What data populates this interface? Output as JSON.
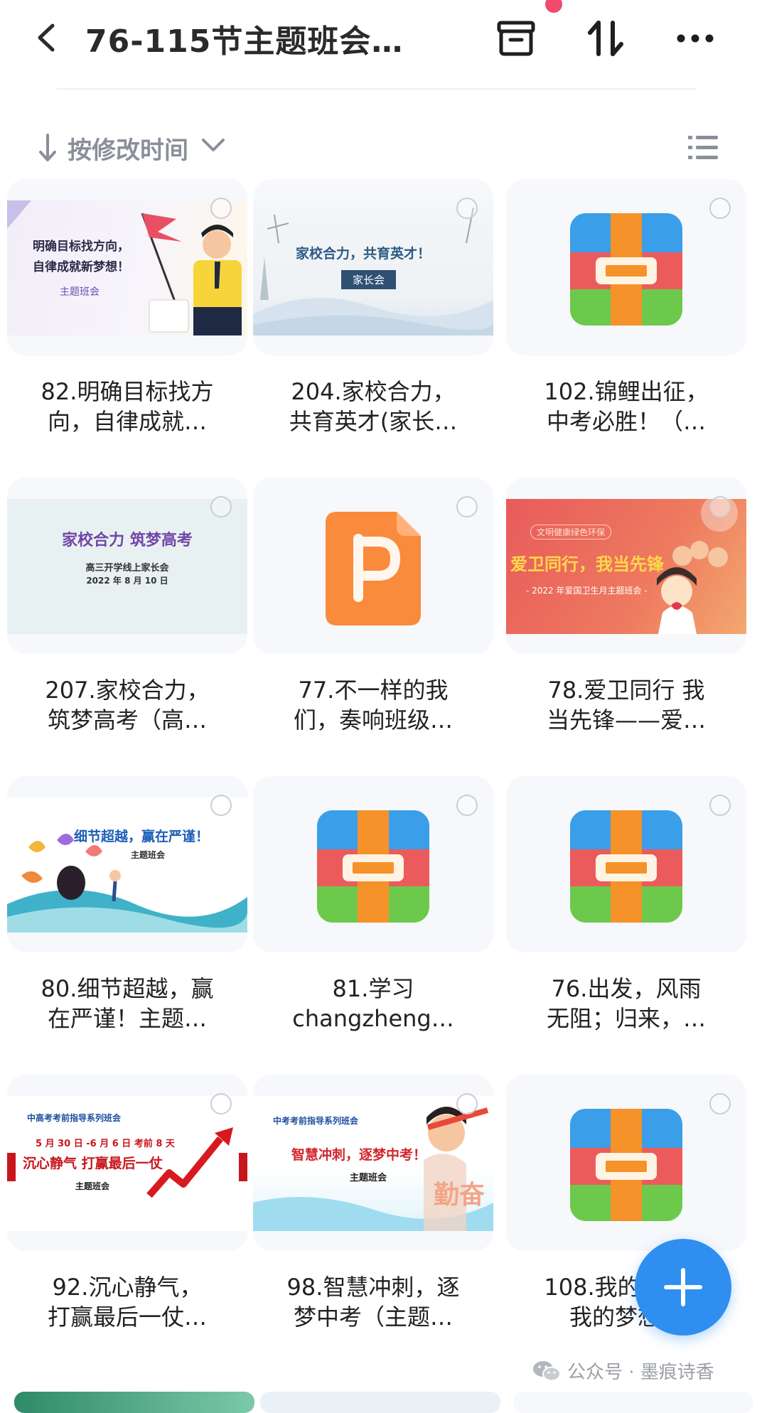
{
  "header": {
    "title": "76-115节主题班会…",
    "back_icon": "chevron-left-icon",
    "archive_icon": "archive-box-icon",
    "sort_toggle_icon": "swap-vertical-icon",
    "more_icon": "more-horizontal-icon",
    "notification_dot_color": "#f24a6f"
  },
  "sort": {
    "label": "按修改时间",
    "arrow_icon": "arrow-down-icon",
    "dropdown_icon": "chevron-down-icon",
    "view_icon": "list-view-icon"
  },
  "files": [
    {
      "name": "82.明确目标找方\n向，自律成就…",
      "thumb": "ppt-slide",
      "slide_lines": [
        "明确目标找方向，",
        "自律成就新梦想！",
        "主题班会"
      ]
    },
    {
      "name": "204.家校合力，\n共育英才(家长…",
      "thumb": "ppt-slide",
      "slide_lines": [
        "家校合力，共育英才！",
        "家长会"
      ]
    },
    {
      "name": "102.锦鲤出征，\n中考必胜！（…",
      "thumb": "archive-icon"
    },
    {
      "name": "207.家校合力，\n筑梦高考（高…",
      "thumb": "ppt-slide",
      "slide_lines": [
        "家校合力  筑梦高考",
        "高三开学线上家长会",
        "2022 年 8 月 10 日"
      ]
    },
    {
      "name": "77.不一样的我\n们，奏响班级…",
      "thumb": "ppt-icon"
    },
    {
      "name": "78.爱卫同行 我\n当先锋——爱…",
      "thumb": "ppt-slide",
      "slide_lines": [
        "文明健康绿色环保",
        "爱卫同行，我当先锋",
        "- 2022 年爱国卫生月主题班会 -"
      ]
    },
    {
      "name": "80.细节超越，赢\n在严谨！主题…",
      "thumb": "ppt-slide",
      "slide_lines": [
        "细节超越，赢在严谨！",
        "主题班会"
      ]
    },
    {
      "name": "81.学习\nchangzheng…",
      "thumb": "archive-icon"
    },
    {
      "name": "76.出发，风雨\n无阻；归来，…",
      "thumb": "archive-icon"
    },
    {
      "name": "92.沉心静气，\n打赢最后一仗…",
      "thumb": "ppt-slide",
      "slide_lines": [
        "中高考考前指导系列班会",
        "5 月 30 日 -6 月 6 日 考前 8 天",
        "沉心静气 打赢最后一仗",
        "主题班会"
      ]
    },
    {
      "name": "98.智慧冲刺，逐\n梦中考（主题…",
      "thumb": "ppt-slide",
      "slide_lines": [
        "中考考前指导系列班会",
        "智慧冲刺，逐梦中考！",
        "主题班会",
        "勤奋"
      ]
    },
    {
      "name": "108.我的梦想，\n我的梦想…",
      "thumb": "archive-icon"
    }
  ],
  "fab": {
    "icon": "plus-icon",
    "color": "#2f8ff0"
  },
  "watermark": {
    "icon": "wechat-icon",
    "text": "公众号 · 墨痕诗香"
  }
}
